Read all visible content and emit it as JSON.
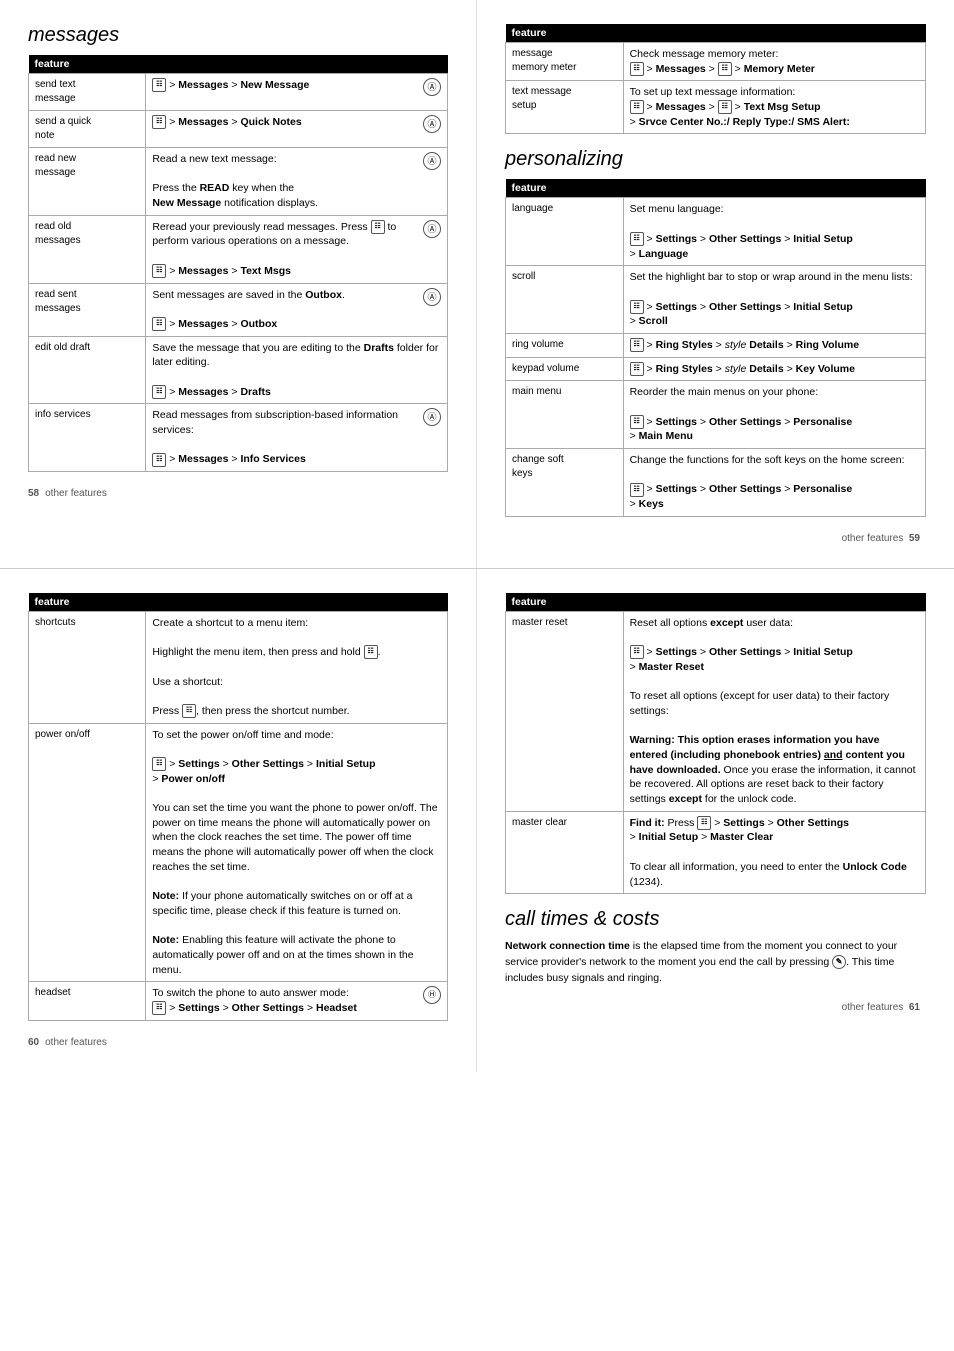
{
  "pages": {
    "page58": {
      "title": "messages",
      "page_number": "58",
      "section": "other features",
      "table": {
        "header": "feature",
        "rows": [
          {
            "feature": "send text message",
            "description": "",
            "path": "&#x1F4F1; > Messages > New Message",
            "icon": "circular",
            "icon_type": "A"
          },
          {
            "feature": "send a quick note",
            "description": "",
            "path": "&#x1F4F1; > Messages > Quick Notes",
            "icon": "circular",
            "icon_type": "A"
          },
          {
            "feature": "read new message",
            "description": "Read a new text message:",
            "description2": "Press the READ key when the New Message notification displays.",
            "path": "",
            "icon": "circular",
            "icon_type": "A"
          },
          {
            "feature": "read old messages",
            "description": "Reread your previously read messages. Press  to perform various operations on a message.",
            "path": "> Messages > Text Msgs",
            "icon": "circular",
            "icon_type": "A"
          },
          {
            "feature": "read sent messages",
            "description": "Sent messages are saved in the Outbox.",
            "path": "> Messages > Outbox",
            "icon": "circular",
            "icon_type": "A"
          },
          {
            "feature": "edit old draft",
            "description": "Save the message that you are editing to the Drafts folder for later editing.",
            "path": "> Messages > Drafts",
            "icon": ""
          },
          {
            "feature": "info services",
            "description": "Read messages from subscription-based information services:",
            "path": "> Messages > Info Services",
            "icon": "circular",
            "icon_type": "A"
          }
        ]
      }
    },
    "page59": {
      "section": "other features",
      "page_number": "59",
      "table": {
        "header": "feature",
        "rows": [
          {
            "feature": "message memory meter",
            "description": "Check message memory meter:",
            "path": "> Messages >  > Memory Meter"
          },
          {
            "feature": "text message setup",
            "description": "To set up text message information:",
            "path": "> Messages >  > Text Msg Setup\n> Srvce Center No.:/ Reply Type:/ SMS Alert:"
          }
        ]
      },
      "personalizing": {
        "title": "personalizing",
        "table": {
          "header": "feature",
          "rows": [
            {
              "feature": "language",
              "description": "Set menu language:",
              "path": "> Settings > Other Settings > Initial Setup\n> Language"
            },
            {
              "feature": "scroll",
              "description": "Set the highlight bar to stop or wrap around in the menu lists:",
              "path": "> Settings > Other Settings > Initial Setup\n> Scroll"
            },
            {
              "feature": "ring volume",
              "description": "",
              "path": "> Ring Styles > style Details > Ring Volume"
            },
            {
              "feature": "keypad volume",
              "description": "",
              "path": "> Ring Styles > style Details > Key Volume"
            },
            {
              "feature": "main menu",
              "description": "Reorder the main menus on your phone:",
              "path": "> Settings > Other Settings > Personalise\n> Main Menu"
            },
            {
              "feature": "change soft keys",
              "description": "Change the functions for the soft keys on the home screen:",
              "path": "> Settings > Other Settings > Personalise\n> Keys"
            }
          ]
        }
      }
    },
    "page60": {
      "page_number": "60",
      "section": "other features",
      "table": {
        "header": "feature",
        "rows": [
          {
            "feature": "shortcuts",
            "lines": [
              "Create a shortcut to a menu item:",
              "Highlight the menu item, then press and hold .",
              "Use a shortcut:",
              "Press , then press the shortcut number."
            ]
          },
          {
            "feature": "power on/off",
            "lines": [
              "To set the power on/off time and mode:",
              "PATH: > Settings > Other Settings > Initial Setup\n> Power on/off",
              "You can set the time you want the phone to power on/off. The power on time means the phone will automatically power on when the clock reaches the set time. The power off time means the phone will automatically power off when the clock reaches the set time.",
              "Note: If your phone automatically switches on or off at a specific time, please check if this feature is turned on.",
              "Note: Enabling this feature will activate the phone to automatically power off and on at the times shown in the menu."
            ]
          },
          {
            "feature": "headset",
            "description": "To switch the phone to auto answer mode:",
            "path": "> Settings > Other Settings > Headset",
            "icon": "headset"
          }
        ]
      }
    },
    "page61": {
      "page_number": "61",
      "section": "other features",
      "table": {
        "header": "feature",
        "rows": [
          {
            "feature": "master reset",
            "lines": [
              "Reset all options except user data:",
              "PATH: > Settings > Other Settings > Initial Setup\n> Master Reset",
              "To reset all options (except for user data) to their factory settings:",
              "WARNING: This option erases information you have entered (including phonebook entries) and content you have downloaded. Once you erase the information, it cannot be recovered. All options are reset back to their factory settings except for the unlock code."
            ]
          },
          {
            "feature": "master clear",
            "lines": [
              "Find it: Press  > Settings > Other Settings\n> Initial Setup > Master Clear",
              "To clear all information, you need to enter the Unlock Code (1234)."
            ]
          }
        ]
      },
      "call_times": {
        "title": "call times & costs",
        "text": "Network connection time is the elapsed time from the moment you connect to your service provider's network to the moment you end the call by pressing . This time includes busy signals and ringing."
      }
    }
  }
}
